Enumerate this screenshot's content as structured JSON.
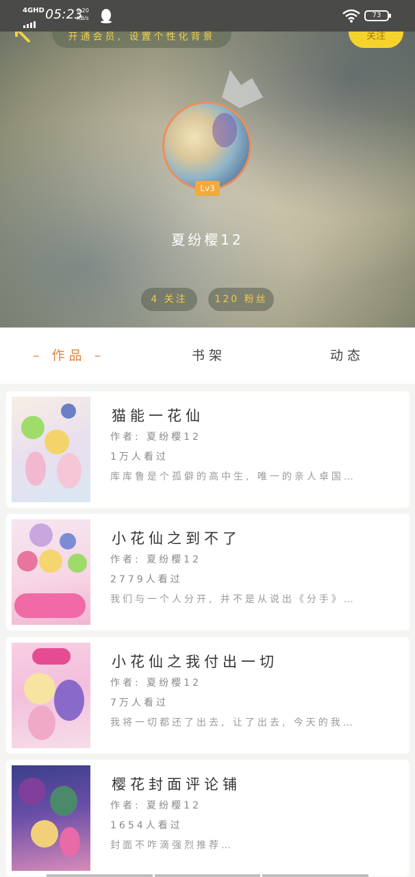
{
  "status_bar": {
    "network": "4GHD",
    "time": "05:23",
    "speed_value": "0.20",
    "speed_unit": "KB/s",
    "battery": "73"
  },
  "header": {
    "notice": "开通会员, 设置个性化背景",
    "follow_label": "关注",
    "level": "Lv3",
    "username": "夏纷樱12",
    "following": "4 关注",
    "fans": "120 粉丝"
  },
  "tabs": [
    {
      "label": "– 作品 –",
      "active": true
    },
    {
      "label": "书架",
      "active": false
    },
    {
      "label": "动态",
      "active": false
    }
  ],
  "works": [
    {
      "title": "猫能一花仙",
      "author": "作者: 夏纷樱12",
      "views": "1万人看过",
      "desc": "库库鲁是个孤僻的高中生, 唯一的亲人卓国…"
    },
    {
      "title": "小花仙之到不了",
      "author": "作者: 夏纷樱12",
      "views": "2779人看过",
      "desc": "我们与一个人分开, 并不是从说出《分手》…"
    },
    {
      "title": "小花仙之我付出一切",
      "author": "作者: 夏纷樱12",
      "views": "7万人看过",
      "desc": "我将一切都还了出去, 让了出去, 今天的我…"
    },
    {
      "title": "樱花封面评论铺",
      "author": "作者: 夏纷樱12",
      "views": "1654人看过",
      "desc": "封面不咋滴强烈推荐…"
    }
  ],
  "colors": {
    "accent": "#e1823d",
    "follow": "#f6d22c",
    "stat_text": "#f2c94a"
  }
}
